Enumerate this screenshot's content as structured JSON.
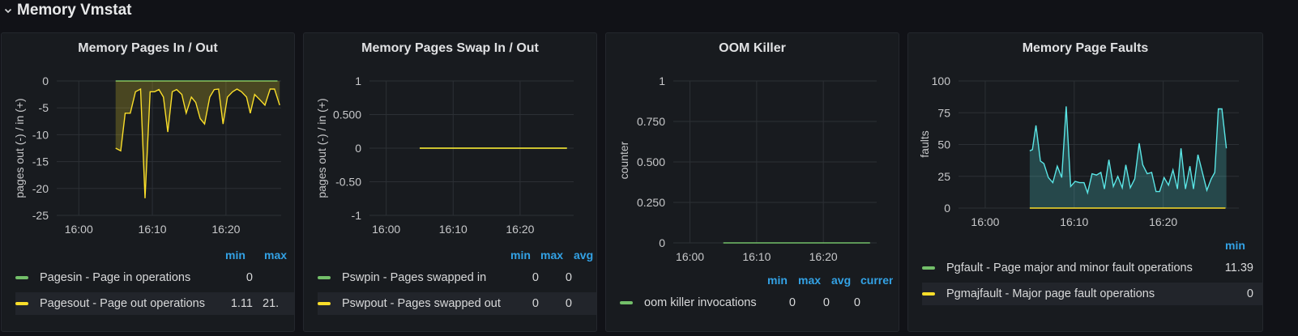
{
  "row": {
    "title": "Memory Vmstat",
    "collapse_icon": "chevron-down-icon"
  },
  "colors": {
    "green": "#73bf69",
    "yellow": "#fade2a",
    "cyan": "#5ae6e6",
    "legend_header": "#33a2e5",
    "grid": "#2c3035",
    "background": "#111217",
    "panel": "#181b1f"
  },
  "panels": [
    {
      "title": "Memory Pages In / Out",
      "ylabel": "pages out (-) / in (+)",
      "yticks": [
        "0",
        "-5",
        "-10",
        "-15",
        "-20",
        "-25"
      ],
      "xticks": [
        "16:00",
        "16:10",
        "16:20"
      ],
      "legend_headers": [
        "min",
        "max"
      ],
      "legend": [
        {
          "name": "Pagesin - Page in operations",
          "color": "green",
          "min": "0",
          "max": ""
        },
        {
          "name": "Pagesout - Page out operations",
          "color": "yellow",
          "min": "1.11",
          "max": "21."
        }
      ]
    },
    {
      "title": "Memory Pages Swap In / Out",
      "ylabel": "pages out (-) / in (+)",
      "yticks": [
        "1",
        "0.500",
        "0",
        "-0.50",
        "-1"
      ],
      "xticks": [
        "16:00",
        "16:10",
        "16:20"
      ],
      "legend_headers": [
        "min",
        "max",
        "avg"
      ],
      "legend": [
        {
          "name": "Pswpin - Pages swapped in",
          "color": "green",
          "min": "0",
          "max": "0"
        },
        {
          "name": "Pswpout - Pages swapped out",
          "color": "yellow",
          "min": "0",
          "max": "0"
        }
      ]
    },
    {
      "title": "OOM Killer",
      "ylabel": "counter",
      "yticks": [
        "1",
        "0.750",
        "0.500",
        "0.250",
        "0"
      ],
      "xticks": [
        "16:00",
        "16:10",
        "16:20"
      ],
      "legend_headers": [
        "min",
        "max",
        "avg",
        "curren"
      ],
      "legend": [
        {
          "name": "oom killer invocations",
          "color": "green",
          "min": "0",
          "max": "0",
          "avg": "0"
        }
      ]
    },
    {
      "title": "Memory Page Faults",
      "ylabel": "faults",
      "yticks": [
        "100",
        "75",
        "50",
        "25",
        "0"
      ],
      "xticks": [
        "16:00",
        "16:10",
        "16:20"
      ],
      "legend_headers": [
        "min"
      ],
      "legend": [
        {
          "name": "Pgfault - Page major and minor fault operations",
          "color": "green",
          "min": "11.39"
        },
        {
          "name": "Pgmajfault - Major page fault operations",
          "color": "yellow",
          "min": "0"
        }
      ]
    }
  ],
  "chart_data": [
    {
      "type": "area",
      "title": "Memory Pages In / Out",
      "ylabel": "pages out (-) / in (+)",
      "ylim": [
        -25,
        0
      ],
      "x_range": [
        "16:00",
        "16:28"
      ],
      "grid": true,
      "series": [
        {
          "name": "Pagesin - Page in operations",
          "color": "green",
          "points": [
            [
              "16:05",
              0
            ],
            [
              "16:27",
              0
            ]
          ]
        },
        {
          "name": "Pagesout - Page out operations",
          "color": "yellow",
          "points": [
            [
              "16:05",
              -12.5
            ],
            [
              "16:05.7",
              -13
            ],
            [
              "16:06.3",
              -6
            ],
            [
              "16:07",
              -6
            ],
            [
              "16:07.7",
              -2
            ],
            [
              "16:08.4",
              -1.5
            ],
            [
              "16:09",
              -21.8
            ],
            [
              "16:09.7",
              -2
            ],
            [
              "16:10.3",
              -2
            ],
            [
              "16:10.9",
              -1.6
            ],
            [
              "16:11.5",
              -3
            ],
            [
              "16:12.1",
              -9.5
            ],
            [
              "16:12.7",
              -2
            ],
            [
              "16:13.3",
              -1.6
            ],
            [
              "16:14",
              -2.5
            ],
            [
              "16:14.6",
              -6
            ],
            [
              "16:15.3",
              -3
            ],
            [
              "16:15.9",
              -4
            ],
            [
              "16:16.5",
              -7
            ],
            [
              "16:17.1",
              -8
            ],
            [
              "16:17.8",
              -3
            ],
            [
              "16:18.4",
              -1.6
            ],
            [
              "16:19",
              -1.5
            ],
            [
              "16:19.6",
              -8
            ],
            [
              "16:20.2",
              -3
            ],
            [
              "16:20.9",
              -2
            ],
            [
              "16:21.5",
              -1.5
            ],
            [
              "16:22.1",
              -2
            ],
            [
              "16:22.8",
              -3
            ],
            [
              "16:23.3",
              -6
            ],
            [
              "16:23.9",
              -2.5
            ],
            [
              "16:24.6",
              -3.5
            ],
            [
              "16:25.3",
              -4.5
            ],
            [
              "16:26",
              -1.5
            ],
            [
              "16:26.6",
              -1.5
            ],
            [
              "16:27.3",
              -4.5
            ]
          ]
        }
      ]
    },
    {
      "type": "line",
      "title": "Memory Pages Swap In / Out",
      "ylabel": "pages out (-) / in (+)",
      "ylim": [
        -1,
        1
      ],
      "grid": true,
      "series": [
        {
          "name": "Pswpin - Pages swapped in",
          "color": "green",
          "points": [
            [
              "16:05",
              0
            ],
            [
              "16:27",
              0
            ]
          ]
        },
        {
          "name": "Pswpout - Pages swapped out",
          "color": "yellow",
          "points": [
            [
              "16:05",
              0
            ],
            [
              "16:27",
              0
            ]
          ]
        }
      ]
    },
    {
      "type": "line",
      "title": "OOM Killer",
      "ylabel": "counter",
      "ylim": [
        0,
        1
      ],
      "grid": true,
      "series": [
        {
          "name": "oom killer invocations",
          "color": "green",
          "points": [
            [
              "16:05",
              0
            ],
            [
              "16:27",
              0
            ]
          ]
        }
      ]
    },
    {
      "type": "area",
      "title": "Memory Page Faults",
      "ylabel": "faults",
      "ylim": [
        0,
        100
      ],
      "grid": true,
      "series": [
        {
          "name": "Pgfault - Page major and minor fault operations",
          "color": "cyan",
          "points": [
            [
              "16:05",
              45
            ],
            [
              "16:05.3",
              46
            ],
            [
              "16:05.7",
              65
            ],
            [
              "16:06.2",
              37
            ],
            [
              "16:06.6",
              35
            ],
            [
              "16:07.1",
              24
            ],
            [
              "16:07.6",
              20
            ],
            [
              "16:08.1",
              33
            ],
            [
              "16:08.6",
              24
            ],
            [
              "16:09.1",
              80
            ],
            [
              "16:09.6",
              17
            ],
            [
              "16:10.1",
              21
            ],
            [
              "16:10.6",
              20
            ],
            [
              "16:11.1",
              20
            ],
            [
              "16:11.5",
              12
            ],
            [
              "16:12",
              27
            ],
            [
              "16:12.5",
              26
            ],
            [
              "16:13",
              28
            ],
            [
              "16:13.4",
              15
            ],
            [
              "16:13.9",
              38
            ],
            [
              "16:14.4",
              17
            ],
            [
              "16:14.9",
              25
            ],
            [
              "16:15.4",
              16
            ],
            [
              "16:15.8",
              34
            ],
            [
              "16:16.3",
              16
            ],
            [
              "16:16.8",
              23
            ],
            [
              "16:17.3",
              51
            ],
            [
              "16:17.7",
              34
            ],
            [
              "16:18.2",
              27
            ],
            [
              "16:18.7",
              28
            ],
            [
              "16:19.2",
              13
            ],
            [
              "16:19.6",
              13
            ],
            [
              "16:20.1",
              24
            ],
            [
              "16:20.6",
              18
            ],
            [
              "16:21.1",
              30
            ],
            [
              "16:21.6",
              15
            ],
            [
              "16:22",
              47
            ],
            [
              "16:22.5",
              15
            ],
            [
              "16:23",
              33
            ],
            [
              "16:23.4",
              15
            ],
            [
              "16:23.9",
              42
            ],
            [
              "16:24.4",
              28
            ],
            [
              "16:24.9",
              14
            ],
            [
              "16:25.4",
              23
            ],
            [
              "16:25.8",
              28
            ],
            [
              "16:26.2",
              78
            ],
            [
              "16:26.6",
              78
            ],
            [
              "16:27.1",
              47
            ]
          ]
        },
        {
          "name": "Pgmajfault - Major page fault operations",
          "color": "yellow",
          "points": [
            [
              "16:05",
              0
            ],
            [
              "16:27",
              0
            ]
          ]
        }
      ]
    }
  ]
}
